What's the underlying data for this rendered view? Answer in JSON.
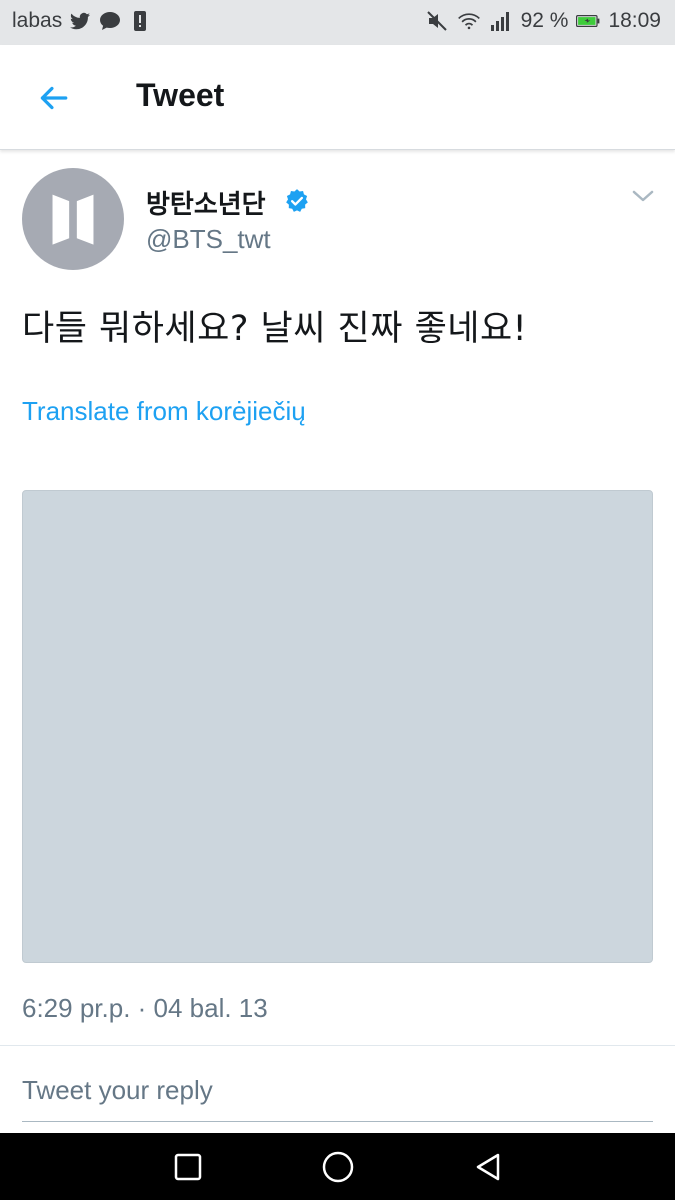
{
  "status_bar": {
    "carrier": "labas",
    "battery_percent": "92 %",
    "time": "18:09",
    "icons": [
      "twitter-icon",
      "chat-icon",
      "alert-icon",
      "mute-icon",
      "wifi-icon",
      "signal-icon",
      "battery-icon"
    ]
  },
  "header": {
    "title": "Tweet",
    "back_icon": "arrow-left-icon"
  },
  "tweet": {
    "display_name": "방탄소년단",
    "handle": "@BTS_twt",
    "verified": true,
    "text": "다들 뭐하세요? 날씨 진짜 좋네요!",
    "translate_label": "Translate from korėjiečių",
    "timestamp": "6:29 pr.p. · 04 bal. 13"
  },
  "reply": {
    "placeholder": "Tweet your reply"
  },
  "colors": {
    "accent": "#1da1f2",
    "text_primary": "#14171a",
    "text_secondary": "#657786",
    "media_placeholder": "#ccd6dd",
    "avatar_bg": "#a6aab3",
    "battery_green": "#3ecc3b"
  },
  "nav_bar": {
    "icons": [
      "recents-square-icon",
      "home-circle-icon",
      "back-triangle-icon"
    ]
  }
}
